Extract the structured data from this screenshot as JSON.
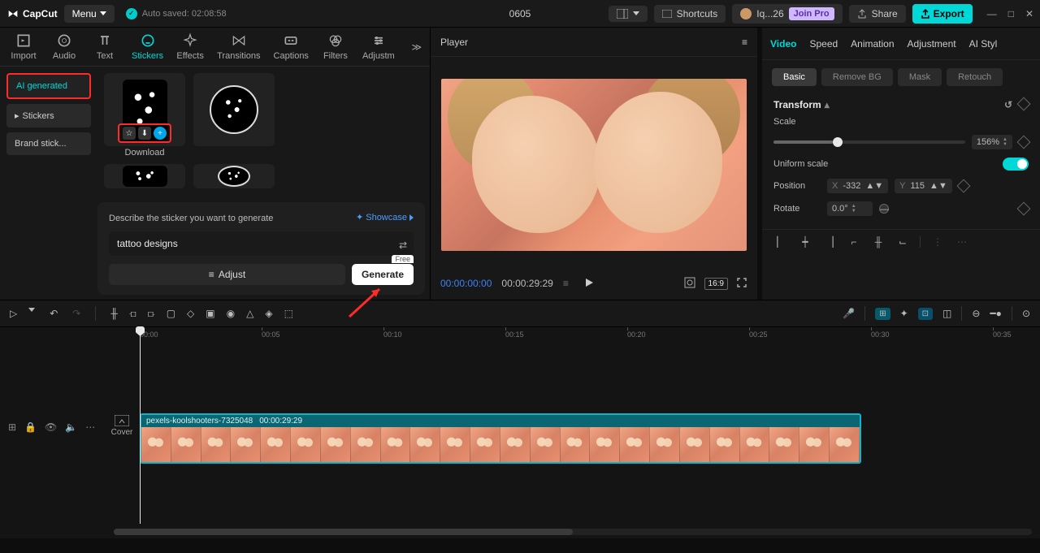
{
  "app": {
    "name": "CapCut",
    "menu": "Menu",
    "autosave": "Auto saved: 02:08:58",
    "title": "0605"
  },
  "topbar": {
    "shortcuts": "Shortcuts",
    "user": "Iq...26",
    "join_pro": "Join Pro",
    "share": "Share",
    "export": "Export"
  },
  "library": {
    "tabs": [
      "Import",
      "Audio",
      "Text",
      "Stickers",
      "Effects",
      "Transitions",
      "Captions",
      "Filters",
      "Adjustm"
    ],
    "active_tab": "Stickers",
    "side": {
      "ai_generated": "AI generated",
      "stickers": "Stickers",
      "brand": "Brand stick..."
    },
    "download_label": "Download",
    "gen": {
      "desc": "Describe the sticker you want to generate",
      "showcase": "Showcase",
      "input": "tattoo designs",
      "adjust": "Adjust",
      "free": "Free",
      "generate": "Generate"
    }
  },
  "player": {
    "title": "Player",
    "time_current": "00:00:00:00",
    "time_duration": "00:00:29:29",
    "ratio": "16:9"
  },
  "inspector": {
    "tabs": [
      "Video",
      "Speed",
      "Animation",
      "Adjustment",
      "AI Styl"
    ],
    "active": "Video",
    "subtabs": [
      "Basic",
      "Remove BG",
      "Mask",
      "Retouch"
    ],
    "sub_active": "Basic",
    "transform": "Transform",
    "scale_label": "Scale",
    "scale_value": "156%",
    "uniform": "Uniform scale",
    "position": "Position",
    "pos_x_label": "X",
    "pos_x": "-332",
    "pos_y_label": "Y",
    "pos_y": "115",
    "rotate": "Rotate",
    "rotate_value": "0.0°"
  },
  "timeline": {
    "ruler": [
      "00:00",
      "00:05",
      "00:10",
      "00:15",
      "00:20",
      "00:25",
      "00:30",
      "00:35"
    ],
    "clip_name": "pexels-koolshooters-7325048",
    "clip_dur": "00:00:29:29",
    "cover": "Cover"
  }
}
